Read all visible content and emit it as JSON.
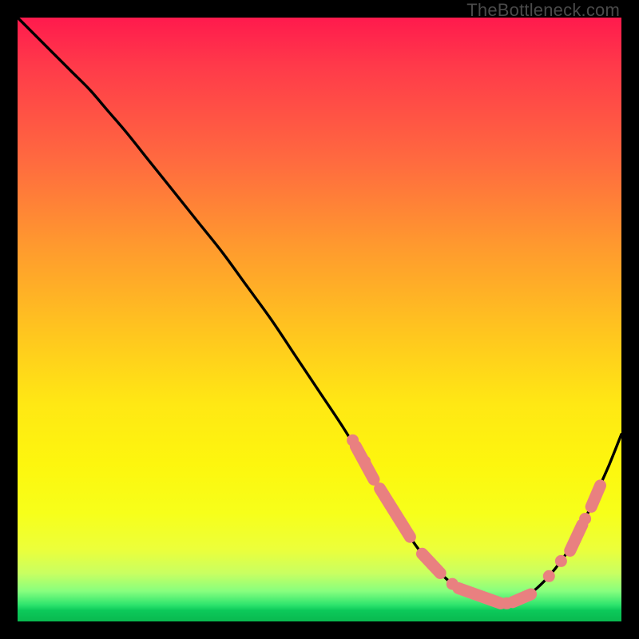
{
  "watermark": "TheBottleneck.com",
  "colors": {
    "curve_stroke": "#000000",
    "marker_fill": "#e98080",
    "marker_stroke": "#e98080"
  },
  "chart_data": {
    "type": "line",
    "title": "",
    "xlabel": "",
    "ylabel": "",
    "xlim": [
      0,
      100
    ],
    "ylim": [
      0,
      100
    ],
    "grid": false,
    "series": [
      {
        "name": "bottleneck-curve",
        "x": [
          0,
          3,
          6,
          9,
          12,
          15,
          18,
          22,
          26,
          30,
          34,
          38,
          42,
          46,
          50,
          54,
          57,
          60,
          62,
          64,
          66,
          68,
          70,
          72,
          74,
          76,
          78,
          80,
          82,
          84,
          86,
          88,
          90,
          92,
          94,
          96,
          98,
          100
        ],
        "values": [
          100,
          97,
          94,
          91,
          88,
          84.5,
          81,
          76,
          71,
          66,
          61,
          55.5,
          50,
          44,
          38,
          32,
          27,
          22,
          18.5,
          15.5,
          12.5,
          10,
          8,
          6.2,
          4.8,
          3.8,
          3.2,
          3,
          3.2,
          4,
          5.5,
          7.5,
          10,
          13,
          17,
          21.5,
          26,
          31
        ]
      }
    ],
    "markers": [
      {
        "shape": "dot",
        "name": "pt-a",
        "x": 55.5,
        "y": 30
      },
      {
        "shape": "dot",
        "name": "pt-b",
        "x": 57.5,
        "y": 26.5
      },
      {
        "shape": "dot",
        "name": "pt-e",
        "x": 72,
        "y": 6.2
      },
      {
        "shape": "dot",
        "name": "pt-g",
        "x": 81,
        "y": 3
      },
      {
        "shape": "dot",
        "name": "pt-i",
        "x": 88,
        "y": 7.5
      },
      {
        "shape": "dot",
        "name": "pt-j",
        "x": 90,
        "y": 10
      },
      {
        "shape": "dot",
        "name": "pt-l",
        "x": 94,
        "y": 17
      },
      {
        "shape": "bar",
        "name": "seg-a",
        "x1": 56,
        "y1": 29,
        "x2": 59,
        "y2": 23.5
      },
      {
        "shape": "bar",
        "name": "seg-b",
        "x1": 60,
        "y1": 22,
        "x2": 65,
        "y2": 14
      },
      {
        "shape": "bar",
        "name": "seg-c",
        "x1": 67,
        "y1": 11.2,
        "x2": 70,
        "y2": 8
      },
      {
        "shape": "bar",
        "name": "seg-d",
        "x1": 73,
        "y1": 5.5,
        "x2": 80,
        "y2": 3
      },
      {
        "shape": "bar",
        "name": "seg-e",
        "x1": 82,
        "y1": 3.2,
        "x2": 85,
        "y2": 4.5
      },
      {
        "shape": "bar",
        "name": "seg-f",
        "x1": 91.5,
        "y1": 11.7,
        "x2": 93.5,
        "y2": 16
      },
      {
        "shape": "bar",
        "name": "seg-g",
        "x1": 95,
        "y1": 19,
        "x2": 96.5,
        "y2": 22.5
      }
    ]
  }
}
